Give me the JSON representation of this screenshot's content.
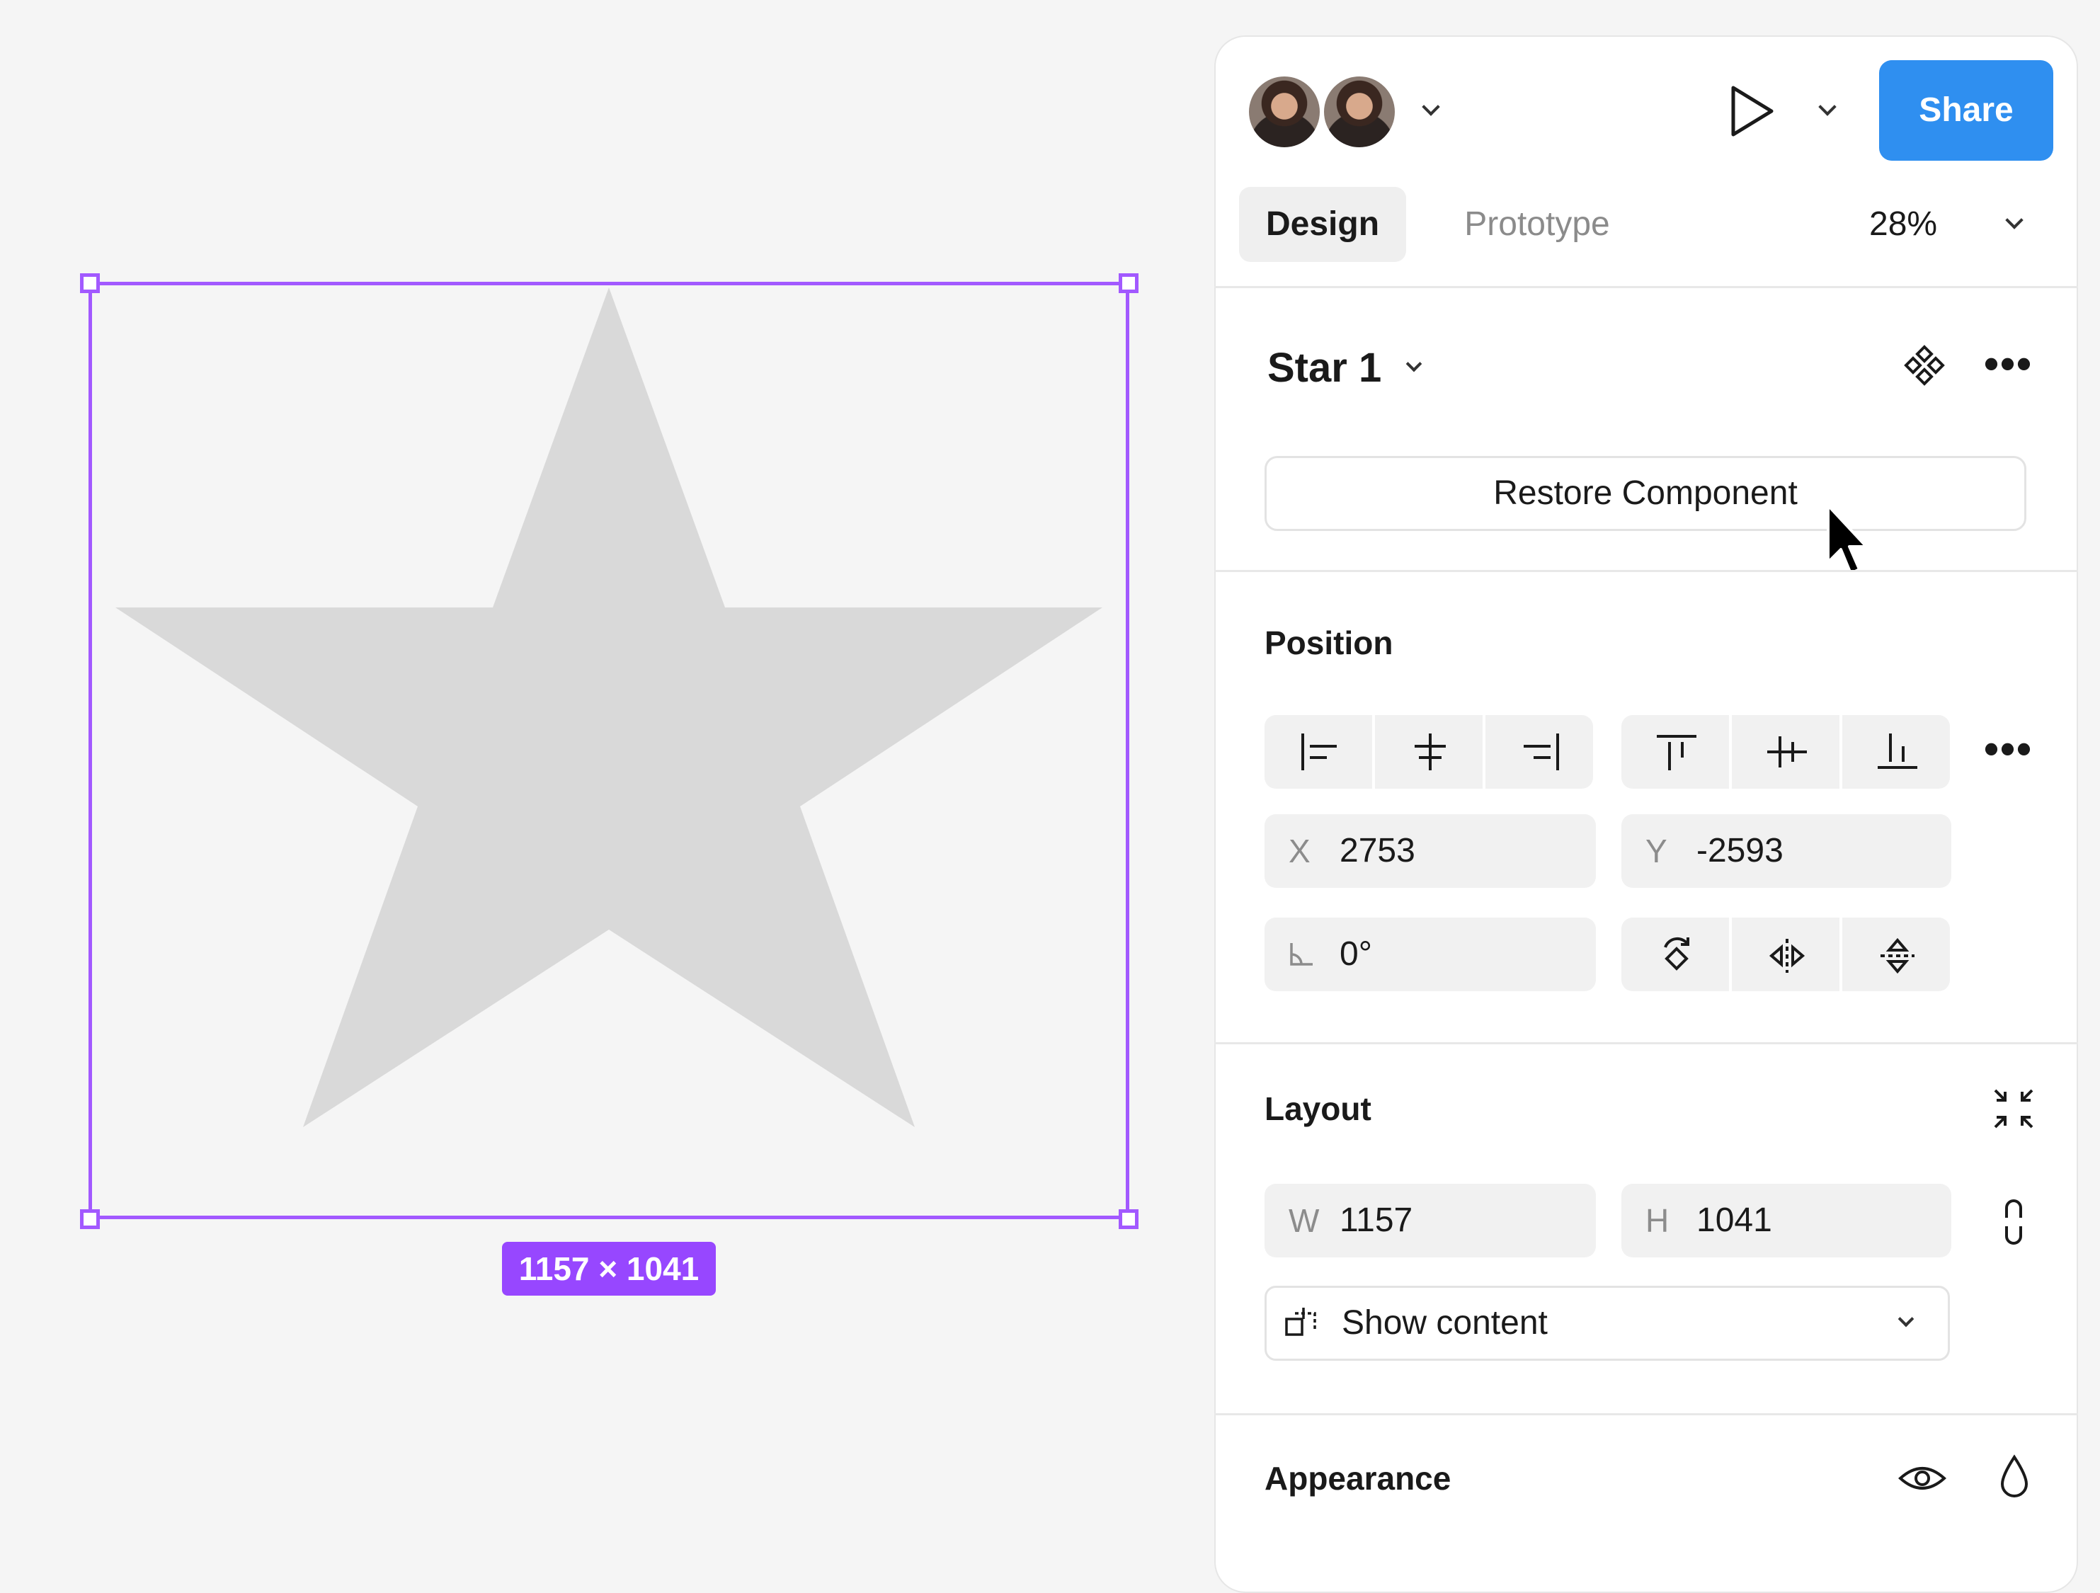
{
  "canvas": {
    "layer_shape": "star",
    "fill_color": "#d9d9d9",
    "selection_color": "#a259ff",
    "size_badge": "1157 × 1041"
  },
  "header": {
    "collaborators": [
      "avatar-1",
      "avatar-2"
    ],
    "share_label": "Share",
    "share_color": "#2f8ff0"
  },
  "tabs": {
    "design": "Design",
    "prototype": "Prototype",
    "zoom": "28%"
  },
  "layer": {
    "name": "Star 1",
    "restore_label": "Restore Component"
  },
  "position": {
    "title": "Position",
    "x_prefix": "X",
    "x_value": "2753",
    "y_prefix": "Y",
    "y_value": "-2593",
    "rotation_value": "0°"
  },
  "layout": {
    "title": "Layout",
    "w_prefix": "W",
    "w_value": "1157",
    "h_prefix": "H",
    "h_value": "1041",
    "clip_label": "Show content"
  },
  "appearance": {
    "title": "Appearance"
  }
}
